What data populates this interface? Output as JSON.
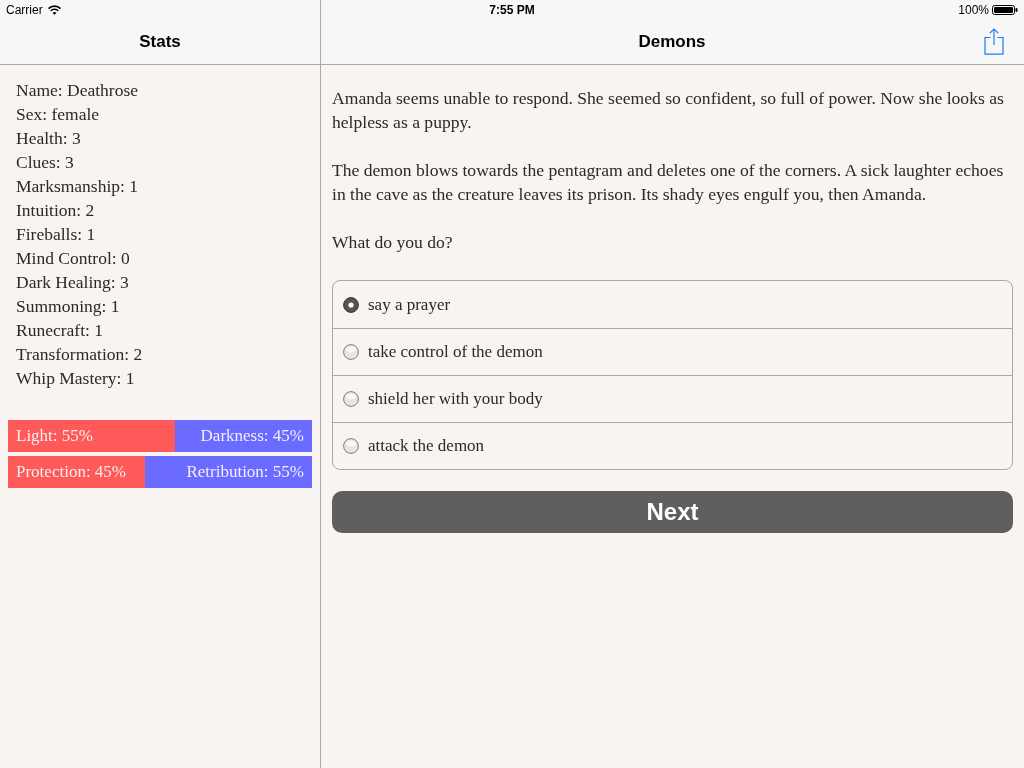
{
  "status_bar": {
    "carrier": "Carrier",
    "time": "7:55 PM",
    "battery": "100%"
  },
  "sidebar": {
    "title": "Stats",
    "stats": [
      "Name: Deathrose",
      "Sex: female",
      "Health: 3",
      "Clues: 3",
      "Marksmanship: 1",
      "Intuition: 2",
      "Fireballs: 1",
      "Mind Control: 0",
      "Dark Healing: 3",
      "Summoning: 1",
      "Runecraft: 1",
      "Transformation: 2",
      "Whip Mastery: 1"
    ],
    "balance_bars": [
      {
        "left_label": "Light: 55%",
        "right_label": "Darkness: 45%",
        "level": 0.55
      },
      {
        "left_label": "Protection: 45%",
        "right_label": "Retribution: 55%",
        "level": 0.45
      }
    ]
  },
  "main": {
    "title": "Demons",
    "paragraphs": [
      "Amanda seems unable to respond. She seemed so confident, so full of power. Now she looks as helpless as a puppy.",
      "The demon blows towards the pentagram and deletes one of the corners. A sick laughter echoes in the cave as the creature leaves its prison. Its shady eyes engulf you, then Amanda.",
      "What do you do?"
    ],
    "choices": [
      {
        "label": "say a prayer",
        "selected": true
      },
      {
        "label": "take control of the demon",
        "selected": false
      },
      {
        "label": "shield her with your body",
        "selected": false
      },
      {
        "label": "attack the demon",
        "selected": false
      }
    ],
    "next_button": "Next"
  }
}
